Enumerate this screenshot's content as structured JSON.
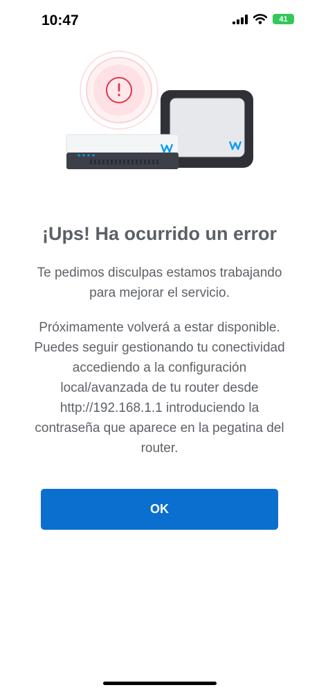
{
  "status_bar": {
    "time": "10:47",
    "battery": "41"
  },
  "illustration": {
    "error_icon": "exclamation-icon",
    "brand_logo": "movistar-m-logo",
    "accent_color": "#e4344a",
    "brand_color": "#019df4"
  },
  "error": {
    "title": "¡Ups! Ha ocurrido un error",
    "message": "Te pedimos disculpas estamos trabajando para mejorar el servicio.",
    "details": "Próximamente volverá a estar disponible. Puedes seguir gestionando tu conectividad accediendo a la configuración local/avanzada de tu router desde  http://192.168.1.1 introduciendo la contraseña que aparece en la pegatina del router."
  },
  "actions": {
    "ok_label": "OK"
  }
}
